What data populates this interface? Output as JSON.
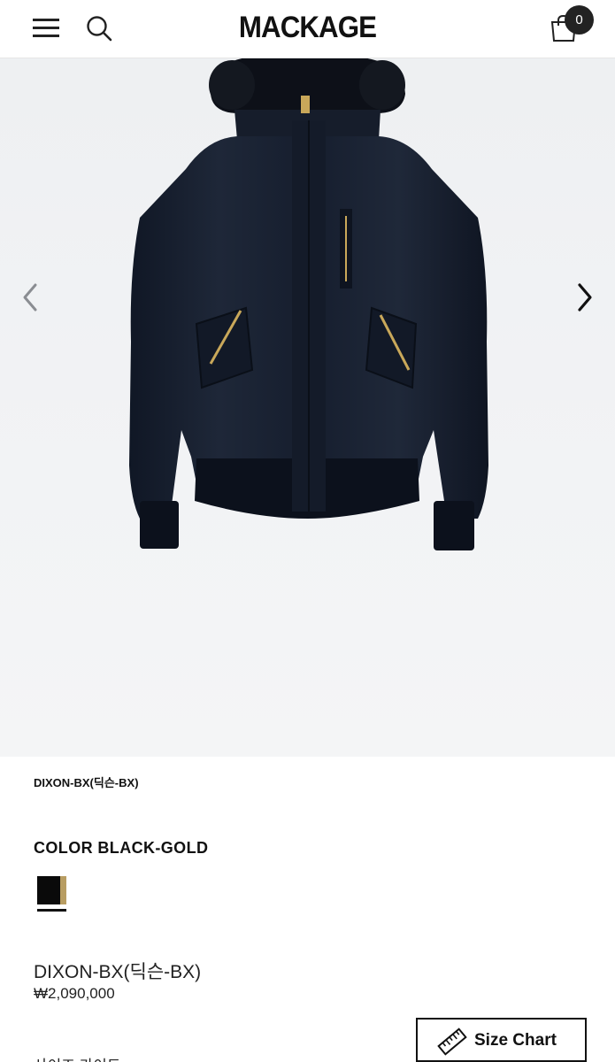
{
  "header": {
    "brand": "MACKAGE",
    "cart_count": "0"
  },
  "hero": {
    "image_alt": "",
    "icons": {
      "prev": "chevron-left-icon",
      "next": "chevron-right-icon"
    }
  },
  "product": {
    "breadcrumb": "DIXON-BX(딕슨-BX)",
    "color_label": "COLOR BLACK-GOLD",
    "swatch_colors": {
      "primary": "#0a0a0a",
      "accent": "#b89d62"
    },
    "name": "DIXON-BX(딕슨-BX)",
    "price": "₩2,090,000",
    "size_guide_label": "사이즈 가이드",
    "size_chart_label": "Size Chart"
  },
  "colors": {
    "jacket": "#1b2333",
    "zipper": "#c9a85a",
    "background": "#eef0f2"
  }
}
